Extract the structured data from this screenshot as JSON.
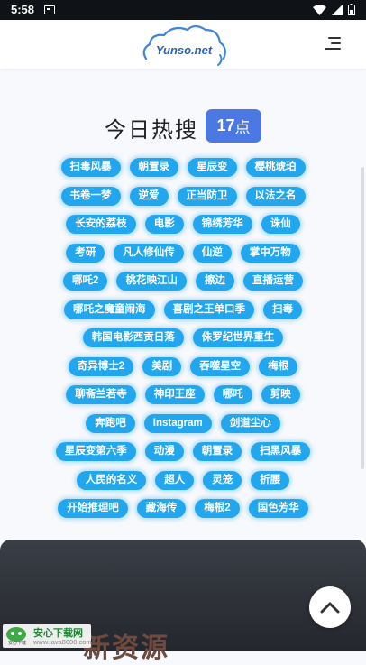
{
  "status_bar": {
    "time": "5:58",
    "icons": [
      "notification-box-icon",
      "wifi-icon",
      "signal-icon",
      "battery-icon"
    ]
  },
  "header": {
    "logo_text": "Yunso.net",
    "menu_icon": "menu-icon"
  },
  "hot_search": {
    "title": "今日热搜",
    "badge_number": "17",
    "badge_unit": "点",
    "rows": [
      [
        "扫毒风暴",
        "朝置录",
        "星辰变",
        "樱桃琥珀"
      ],
      [
        "书卷一梦",
        "逆爱",
        "正当防卫",
        "以法之名"
      ],
      [
        "长安的荔枝",
        "电影",
        "锦绣芳华",
        "诛仙"
      ],
      [
        "考研",
        "凡人修仙传",
        "仙逆",
        "掌中万物"
      ],
      [
        "哪吒2",
        "桃花映江山",
        "擦边",
        "直播运营"
      ],
      [
        "哪吒之魔童闹海",
        "喜剧之王单口季",
        "扫毒"
      ],
      [
        "韩国电影西贡日落",
        "侏罗纪世界重生"
      ],
      [
        "奇异博士2",
        "美剧",
        "吞噬星空",
        "梅根"
      ],
      [
        "聊斋兰若寺",
        "神印王座",
        "哪吒",
        "剪映"
      ],
      [
        "奔跑吧",
        "Instagram",
        "剑道尘心"
      ],
      [
        "星辰变第六季",
        "动漫",
        "朝置录",
        "扫黑风暴"
      ],
      [
        "人民的名义",
        "超人",
        "灵笼",
        "折腰"
      ],
      [
        "开始推理吧",
        "藏海传",
        "梅根2",
        "国色芳华"
      ]
    ]
  },
  "panel": {
    "heading": "新资源"
  },
  "watermark": {
    "title": "安心下载网",
    "url": "www.java8000.com",
    "logo_text": "安心下载"
  },
  "colors": {
    "tag": "#22a7ef",
    "badge": "#4b78e3",
    "panel": "#2f3238"
  }
}
